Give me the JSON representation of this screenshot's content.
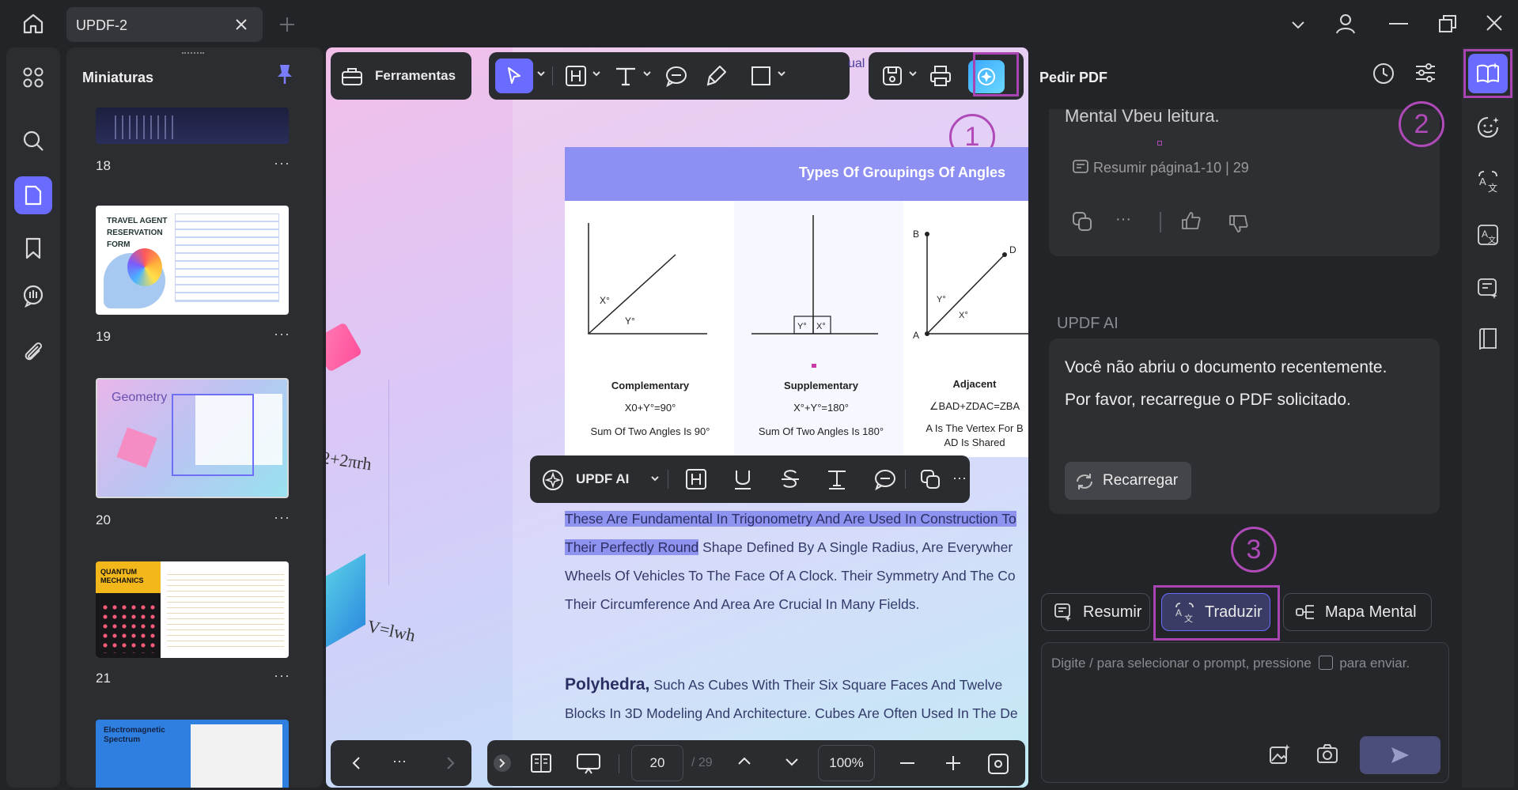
{
  "tab": {
    "title": "UPDF-2"
  },
  "thumbnails": {
    "title": "Miniaturas",
    "pages": [
      {
        "num": "18"
      },
      {
        "num": "19",
        "title": "TRAVEL AGENT RESERVATION FORM"
      },
      {
        "num": "20",
        "title": "Geometry"
      },
      {
        "num": "21",
        "title": "QUANTUM MECHANICS"
      },
      {
        "num": "22",
        "title": "Electromagnetic Spectrum"
      }
    ],
    "more": "···"
  },
  "toolbar": {
    "tools_label": "Ferramentas",
    "ai_label": "UPDF AI",
    "ual_fragment": "ual"
  },
  "document": {
    "chart_title": "Types Of Groupings Of Angles",
    "panels": [
      {
        "name": "Complementary",
        "formula": "X0+Y°=90°",
        "desc": "Sum Of Two Angles Is 90°",
        "x_label": "X°",
        "y_label": "Y°"
      },
      {
        "name": "Supplementary",
        "formula": "X°+Y°=180°",
        "desc": "Sum Of Two Angles Is 180°",
        "x_label": "X°",
        "y_label": "Y°"
      },
      {
        "name": "Adjacent",
        "formula": "∠BAD+ZDAC=ZBA",
        "desc": "A Is The Vertex For B",
        "desc2": "AD Is Shared",
        "b": "B",
        "d": "D",
        "a": "A",
        "x_label": "X°",
        "y_label": "Y°"
      }
    ],
    "lines": [
      "These Are Fundamental In Trigonometry And Are Used In Construction To",
      "Shape Defined By A Single Radius, Are Everywher",
      "Wheels Of Vehicles To The Face Of A Clock. Their Symmetry And The Co",
      "Their Circumference And Area Are Crucial In Many Fields."
    ],
    "highlight_prefix": "Their Perfectly Round",
    "poly_bold": "Polyhedra,",
    "poly_rest": " Such As Cubes With Their Six Square Faces And Twelve",
    "poly_line2": "Blocks In 3D Modeling And Architecture. Cubes Are Often Used In The De",
    "formula_left": "2+2πrh",
    "formula_left2": "V=lwh"
  },
  "bottom_bar": {
    "page_current": "20",
    "page_total": "/ 29",
    "zoom": "100%",
    "more": "···"
  },
  "ai_panel": {
    "title": "Pedir PDF",
    "partial_text": "Mental Vbeu leitura.",
    "summary_link": "Resumir página1-10 | 29",
    "sender": "UPDF AI",
    "message": "Você não abriu o documento recentemente. Por favor, recarregue o PDF solicitado.",
    "reload_label": "Recarregar",
    "chips": [
      "Resumir",
      "Traduzir",
      "Mapa Mental"
    ],
    "placeholder": "Digite / para selecionar o prompt, pressione",
    "placeholder_end": "para enviar."
  },
  "markers": [
    "1",
    "2",
    "3"
  ]
}
